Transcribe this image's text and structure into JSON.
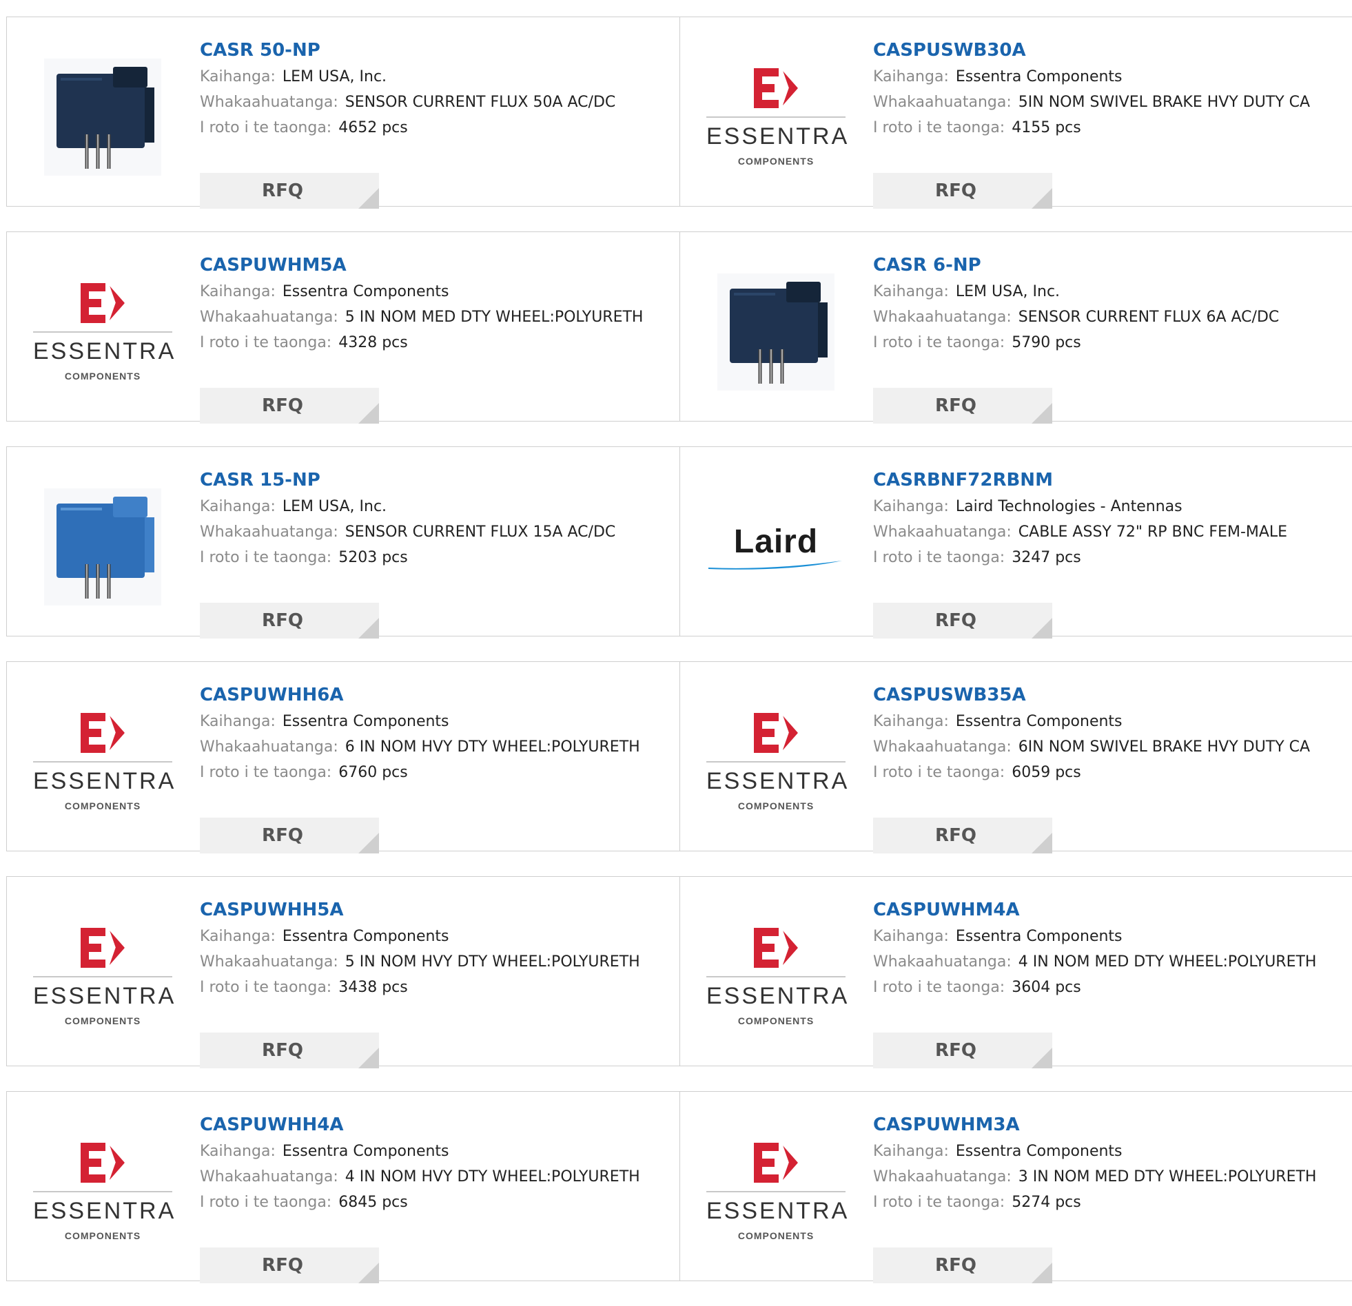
{
  "labels": {
    "manufacturer": "Kaihanga:",
    "description": "Whakaahuatanga:",
    "stock": "I roto i te taonga:",
    "rfq": "RFQ"
  },
  "logo": {
    "essentra_name": "ESSENTRA",
    "essentra_sub": "COMPONENTS",
    "laird_name": "Laird"
  },
  "products": [
    {
      "part": "CASR 50-NP",
      "manufacturer": "LEM USA, Inc.",
      "description": "SENSOR CURRENT FLUX 50A AC/DC",
      "stock": "4652 pcs",
      "image": "lem-sensor-dark"
    },
    {
      "part": "CASPUSWB30A",
      "manufacturer": "Essentra Components",
      "description": "5IN NOM SWIVEL BRAKE HVY DUTY CA",
      "stock": "4155 pcs",
      "image": "essentra-logo"
    },
    {
      "part": "CASPUWHM5A",
      "manufacturer": "Essentra Components",
      "description": "5 IN NOM MED DTY WHEEL:POLYURETH",
      "stock": "4328 pcs",
      "image": "essentra-logo"
    },
    {
      "part": "CASR 6-NP",
      "manufacturer": "LEM USA, Inc.",
      "description": "SENSOR CURRENT FLUX 6A AC/DC",
      "stock": "5790 pcs",
      "image": "lem-sensor-dark"
    },
    {
      "part": "CASR 15-NP",
      "manufacturer": "LEM USA, Inc.",
      "description": "SENSOR CURRENT FLUX 15A AC/DC",
      "stock": "5203 pcs",
      "image": "lem-sensor-blue"
    },
    {
      "part": "CASRBNF72RBNM",
      "manufacturer": "Laird Technologies - Antennas",
      "description": "CABLE ASSY 72\" RP BNC FEM-MALE",
      "stock": "3247 pcs",
      "image": "laird-logo"
    },
    {
      "part": "CASPUWHH6A",
      "manufacturer": "Essentra Components",
      "description": "6 IN NOM HVY DTY WHEEL:POLYURETH",
      "stock": "6760 pcs",
      "image": "essentra-logo"
    },
    {
      "part": "CASPUSWB35A",
      "manufacturer": "Essentra Components",
      "description": "6IN NOM SWIVEL BRAKE HVY DUTY CA",
      "stock": "6059 pcs",
      "image": "essentra-logo"
    },
    {
      "part": "CASPUWHH5A",
      "manufacturer": "Essentra Components",
      "description": "5 IN NOM HVY DTY WHEEL:POLYURETH",
      "stock": "3438 pcs",
      "image": "essentra-logo"
    },
    {
      "part": "CASPUWHM4A",
      "manufacturer": "Essentra Components",
      "description": "4 IN NOM MED DTY WHEEL:POLYURETH",
      "stock": "3604 pcs",
      "image": "essentra-logo"
    },
    {
      "part": "CASPUWHH4A",
      "manufacturer": "Essentra Components",
      "description": "4 IN NOM HVY DTY WHEEL:POLYURETH",
      "stock": "6845 pcs",
      "image": "essentra-logo"
    },
    {
      "part": "CASPUWHM3A",
      "manufacturer": "Essentra Components",
      "description": "3 IN NOM MED DTY WHEEL:POLYURETH",
      "stock": "5274 pcs",
      "image": "essentra-logo"
    }
  ],
  "colors": {
    "part_link": "#1a64ad",
    "essentra_red": "#d42233",
    "laird_swoosh": "#1a8fd6",
    "sensor_dark": "#1f3350",
    "sensor_blue": "#2f6fb8"
  }
}
